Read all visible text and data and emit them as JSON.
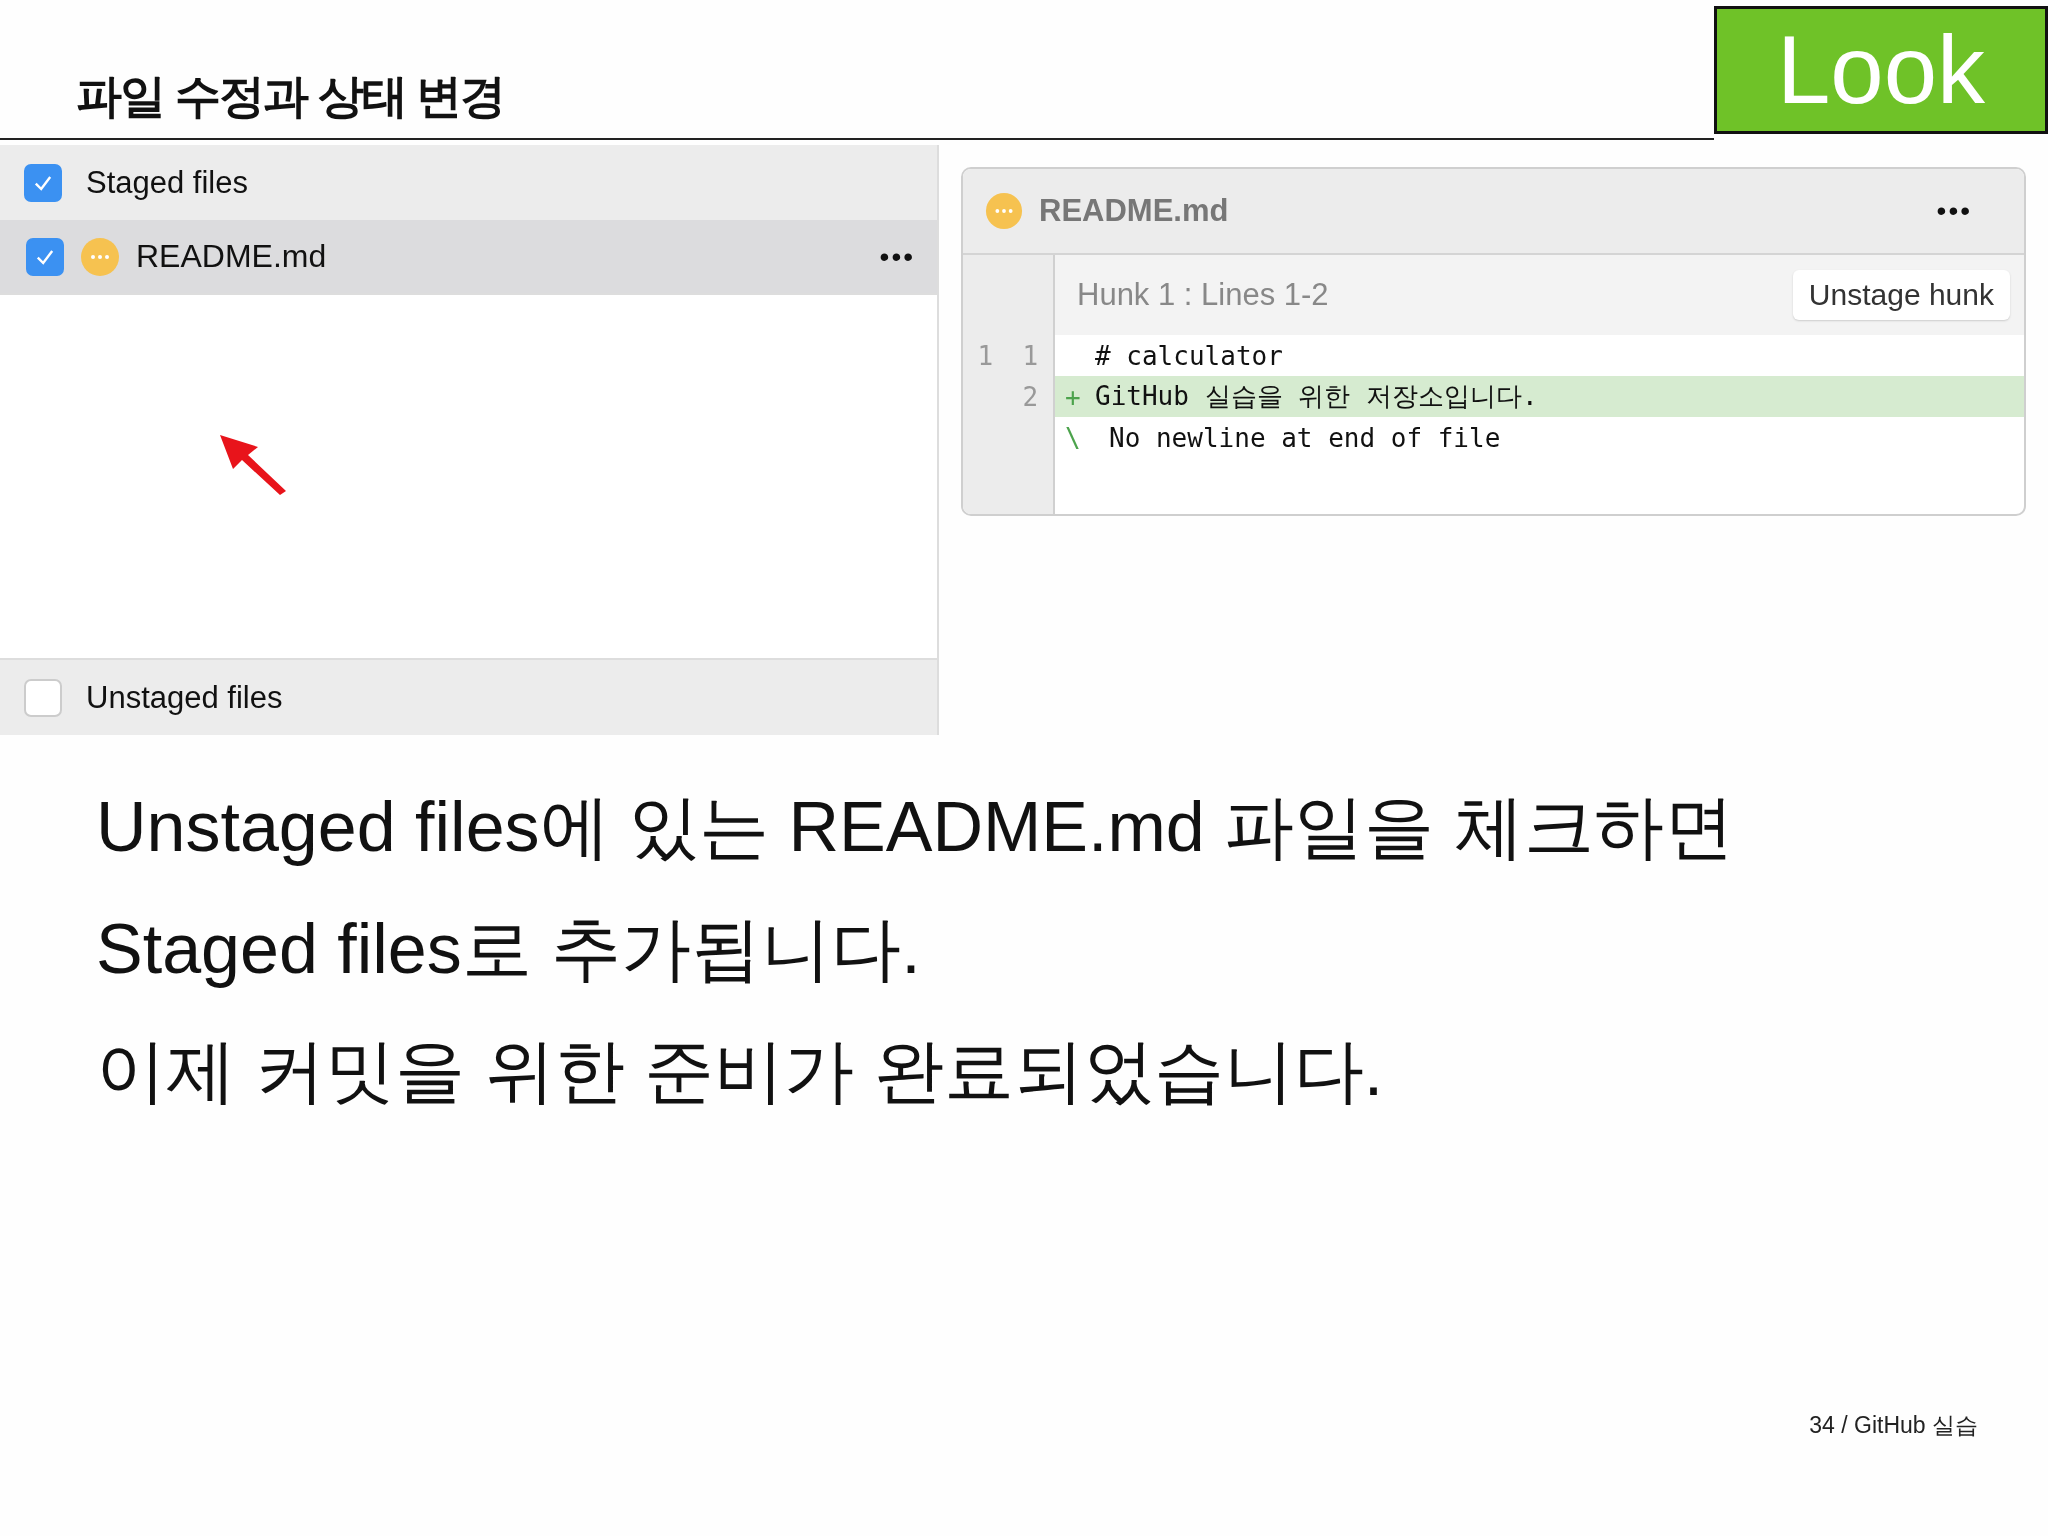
{
  "slide_title": "파일 수정과 상태 변경",
  "badge": "Look",
  "staged": {
    "label": "Staged files",
    "checked": true,
    "files": [
      {
        "name": "README.md",
        "checked": true,
        "selected": true,
        "menu": "•••"
      }
    ]
  },
  "unstaged": {
    "label": "Unstaged files",
    "checked": false
  },
  "diff": {
    "file": "README.md",
    "menu": "•••",
    "hunk_title": "Hunk 1 : Lines 1-2",
    "hunk_button": "Unstage hunk",
    "lines": [
      {
        "kind": "context",
        "old": "1",
        "new": "1",
        "text": "# calculator"
      },
      {
        "kind": "add",
        "new": "2",
        "sign": "+",
        "text": "GitHub 실습을 위한 저장소입니다."
      },
      {
        "kind": "note",
        "sign": "\\",
        "text": "No newline at end of file"
      }
    ]
  },
  "body": [
    "Unstaged files에 있는 README.md 파일을 체크하면",
    "Staged files로 추가됩니다.",
    "이제 커밋을 위한 준비가 완료되었습니다."
  ],
  "footer": "34 / GitHub 실습"
}
